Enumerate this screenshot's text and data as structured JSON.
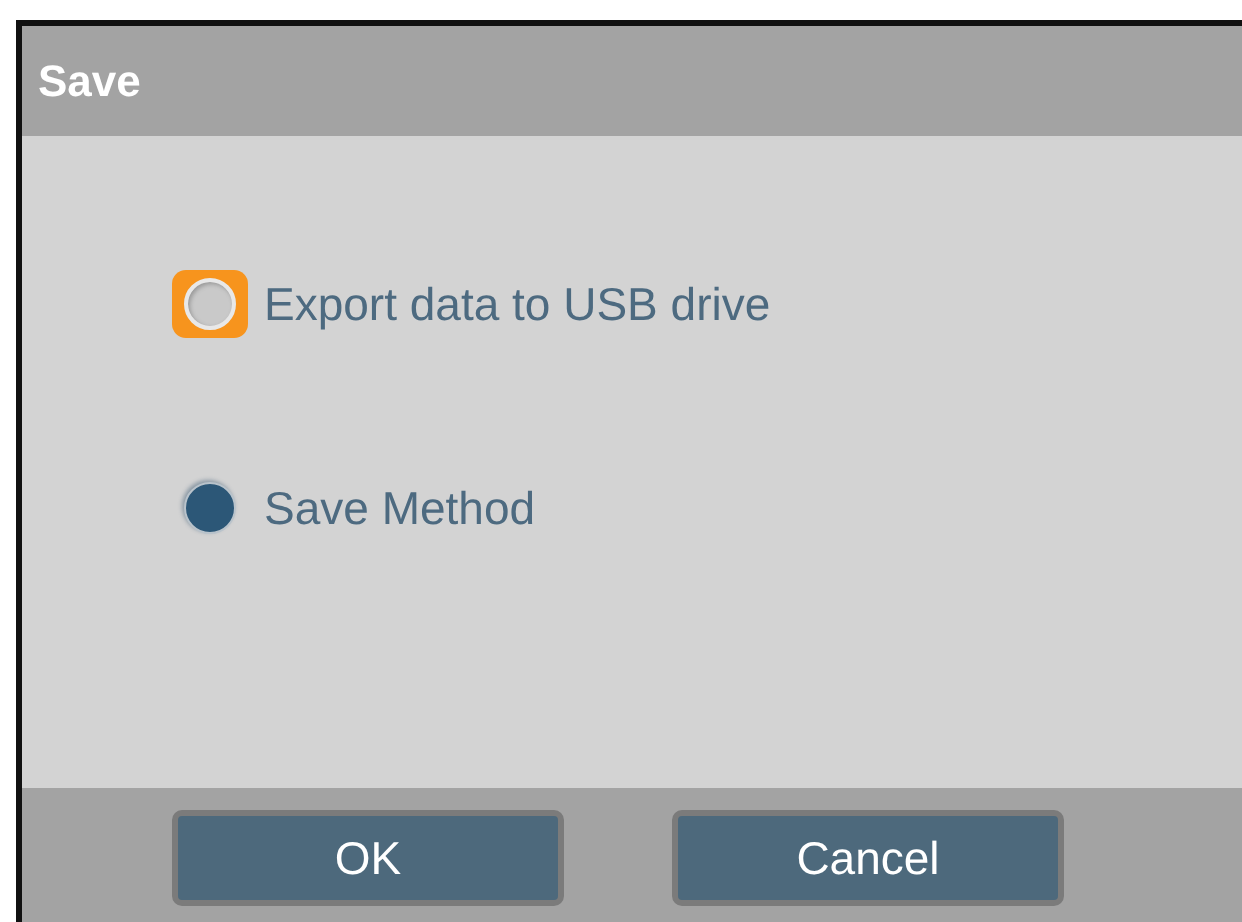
{
  "dialog": {
    "title": "Save"
  },
  "options": [
    {
      "label": "Export data to USB drive",
      "selected": false,
      "focused": true
    },
    {
      "label": "Save Method",
      "selected": true,
      "focused": false
    }
  ],
  "buttons": [
    "OK",
    "Cancel"
  ]
}
